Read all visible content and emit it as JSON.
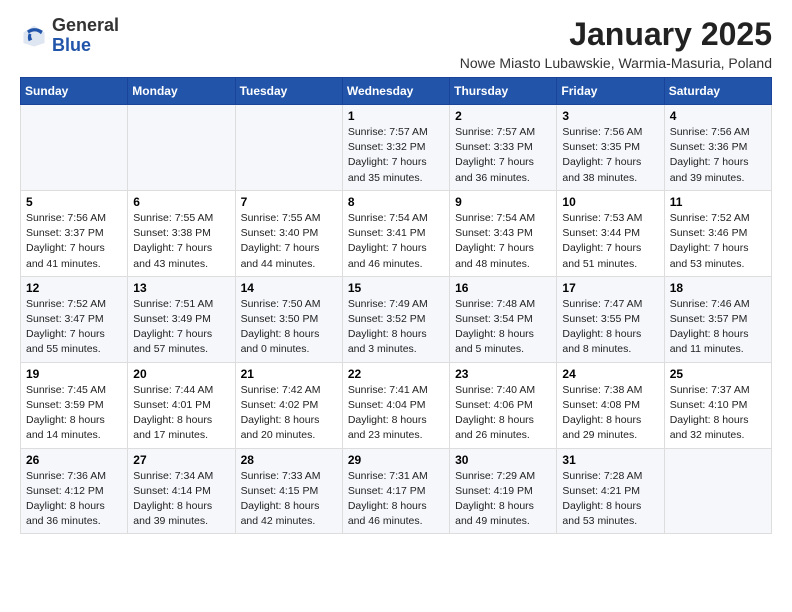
{
  "logo": {
    "general": "General",
    "blue": "Blue"
  },
  "title": "January 2025",
  "location": "Nowe Miasto Lubawskie, Warmia-Masuria, Poland",
  "weekdays": [
    "Sunday",
    "Monday",
    "Tuesday",
    "Wednesday",
    "Thursday",
    "Friday",
    "Saturday"
  ],
  "weeks": [
    [
      {
        "day": "",
        "info": ""
      },
      {
        "day": "",
        "info": ""
      },
      {
        "day": "",
        "info": ""
      },
      {
        "day": "1",
        "info": "Sunrise: 7:57 AM\nSunset: 3:32 PM\nDaylight: 7 hours and 35 minutes."
      },
      {
        "day": "2",
        "info": "Sunrise: 7:57 AM\nSunset: 3:33 PM\nDaylight: 7 hours and 36 minutes."
      },
      {
        "day": "3",
        "info": "Sunrise: 7:56 AM\nSunset: 3:35 PM\nDaylight: 7 hours and 38 minutes."
      },
      {
        "day": "4",
        "info": "Sunrise: 7:56 AM\nSunset: 3:36 PM\nDaylight: 7 hours and 39 minutes."
      }
    ],
    [
      {
        "day": "5",
        "info": "Sunrise: 7:56 AM\nSunset: 3:37 PM\nDaylight: 7 hours and 41 minutes."
      },
      {
        "day": "6",
        "info": "Sunrise: 7:55 AM\nSunset: 3:38 PM\nDaylight: 7 hours and 43 minutes."
      },
      {
        "day": "7",
        "info": "Sunrise: 7:55 AM\nSunset: 3:40 PM\nDaylight: 7 hours and 44 minutes."
      },
      {
        "day": "8",
        "info": "Sunrise: 7:54 AM\nSunset: 3:41 PM\nDaylight: 7 hours and 46 minutes."
      },
      {
        "day": "9",
        "info": "Sunrise: 7:54 AM\nSunset: 3:43 PM\nDaylight: 7 hours and 48 minutes."
      },
      {
        "day": "10",
        "info": "Sunrise: 7:53 AM\nSunset: 3:44 PM\nDaylight: 7 hours and 51 minutes."
      },
      {
        "day": "11",
        "info": "Sunrise: 7:52 AM\nSunset: 3:46 PM\nDaylight: 7 hours and 53 minutes."
      }
    ],
    [
      {
        "day": "12",
        "info": "Sunrise: 7:52 AM\nSunset: 3:47 PM\nDaylight: 7 hours and 55 minutes."
      },
      {
        "day": "13",
        "info": "Sunrise: 7:51 AM\nSunset: 3:49 PM\nDaylight: 7 hours and 57 minutes."
      },
      {
        "day": "14",
        "info": "Sunrise: 7:50 AM\nSunset: 3:50 PM\nDaylight: 8 hours and 0 minutes."
      },
      {
        "day": "15",
        "info": "Sunrise: 7:49 AM\nSunset: 3:52 PM\nDaylight: 8 hours and 3 minutes."
      },
      {
        "day": "16",
        "info": "Sunrise: 7:48 AM\nSunset: 3:54 PM\nDaylight: 8 hours and 5 minutes."
      },
      {
        "day": "17",
        "info": "Sunrise: 7:47 AM\nSunset: 3:55 PM\nDaylight: 8 hours and 8 minutes."
      },
      {
        "day": "18",
        "info": "Sunrise: 7:46 AM\nSunset: 3:57 PM\nDaylight: 8 hours and 11 minutes."
      }
    ],
    [
      {
        "day": "19",
        "info": "Sunrise: 7:45 AM\nSunset: 3:59 PM\nDaylight: 8 hours and 14 minutes."
      },
      {
        "day": "20",
        "info": "Sunrise: 7:44 AM\nSunset: 4:01 PM\nDaylight: 8 hours and 17 minutes."
      },
      {
        "day": "21",
        "info": "Sunrise: 7:42 AM\nSunset: 4:02 PM\nDaylight: 8 hours and 20 minutes."
      },
      {
        "day": "22",
        "info": "Sunrise: 7:41 AM\nSunset: 4:04 PM\nDaylight: 8 hours and 23 minutes."
      },
      {
        "day": "23",
        "info": "Sunrise: 7:40 AM\nSunset: 4:06 PM\nDaylight: 8 hours and 26 minutes."
      },
      {
        "day": "24",
        "info": "Sunrise: 7:38 AM\nSunset: 4:08 PM\nDaylight: 8 hours and 29 minutes."
      },
      {
        "day": "25",
        "info": "Sunrise: 7:37 AM\nSunset: 4:10 PM\nDaylight: 8 hours and 32 minutes."
      }
    ],
    [
      {
        "day": "26",
        "info": "Sunrise: 7:36 AM\nSunset: 4:12 PM\nDaylight: 8 hours and 36 minutes."
      },
      {
        "day": "27",
        "info": "Sunrise: 7:34 AM\nSunset: 4:14 PM\nDaylight: 8 hours and 39 minutes."
      },
      {
        "day": "28",
        "info": "Sunrise: 7:33 AM\nSunset: 4:15 PM\nDaylight: 8 hours and 42 minutes."
      },
      {
        "day": "29",
        "info": "Sunrise: 7:31 AM\nSunset: 4:17 PM\nDaylight: 8 hours and 46 minutes."
      },
      {
        "day": "30",
        "info": "Sunrise: 7:29 AM\nSunset: 4:19 PM\nDaylight: 8 hours and 49 minutes."
      },
      {
        "day": "31",
        "info": "Sunrise: 7:28 AM\nSunset: 4:21 PM\nDaylight: 8 hours and 53 minutes."
      },
      {
        "day": "",
        "info": ""
      }
    ]
  ]
}
